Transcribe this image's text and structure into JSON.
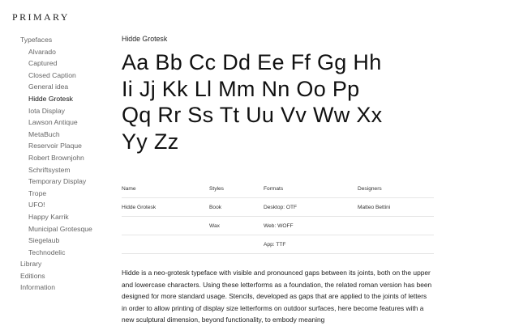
{
  "brand": "PRIMARY",
  "nav": {
    "typefaces": "Typefaces",
    "fonts": [
      {
        "label": "Alvarado",
        "active": false
      },
      {
        "label": "Captured",
        "active": false
      },
      {
        "label": "Closed Caption",
        "active": false
      },
      {
        "label": "General idea",
        "active": false
      },
      {
        "label": "Hidde Grotesk",
        "active": true
      },
      {
        "label": "Iota Display",
        "active": false
      },
      {
        "label": "Lawson Antique",
        "active": false
      },
      {
        "label": "MetaBuch",
        "active": false
      },
      {
        "label": "Reservoir Plaque",
        "active": false
      },
      {
        "label": "Robert Brownjohn",
        "active": false
      },
      {
        "label": "Schriftsystem",
        "active": false
      },
      {
        "label": "Temporary Display",
        "active": false
      },
      {
        "label": "Trope",
        "active": false
      },
      {
        "label": "UFO!",
        "active": false
      },
      {
        "label": "Happy Karrik",
        "active": false
      },
      {
        "label": "Municipal Grotesque",
        "active": false
      },
      {
        "label": "Siegelaub",
        "active": false
      },
      {
        "label": "Technodelic",
        "active": false
      }
    ],
    "library": "Library",
    "editions": "Editions",
    "information": "Information"
  },
  "font": {
    "name": "Hidde Grotesk",
    "specimen": [
      "Aa Bb Cc Dd Ee Ff Gg Hh",
      "Ii Jj Kk Ll Mm Nn Oo Pp",
      "Qq Rr Ss Tt Uu Vv Ww Xx",
      "Yy Zz"
    ]
  },
  "table": {
    "headers": [
      "Name",
      "Styles",
      "Formats",
      "Designers"
    ],
    "rows": [
      [
        "Hidde Grotesk",
        "Book",
        "Desktop: OTF",
        "Matteo Bettini"
      ],
      [
        "",
        "Wax",
        "Web: WOFF",
        ""
      ],
      [
        "",
        "",
        "App: TTF",
        ""
      ]
    ]
  },
  "description": "Hidde is a neo-grotesk typeface with visible and pronounced gaps between its joints, both on the upper and lowercase characters. Using these letterforms as a foundation, the related roman version has been designed for more standard usage. Stencils, developed as gaps that are applied to the joints of letters in order to allow printing of display size letterforms on outdoor surfaces, here become features with a new sculptural dimension, beyond functionality, to embody meaning"
}
